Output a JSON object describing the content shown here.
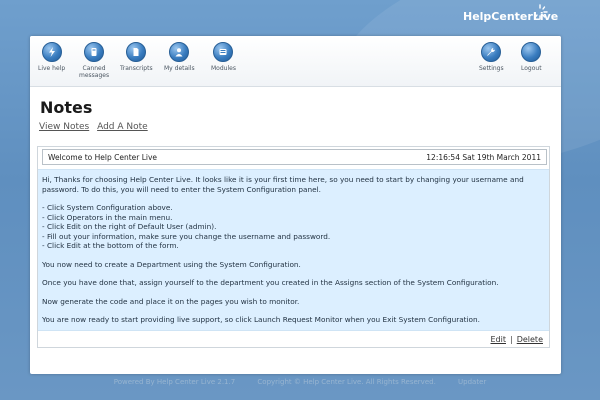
{
  "brand": {
    "name": "HelpCenterLive"
  },
  "toolbar": {
    "left_items": [
      {
        "label": "Live help",
        "icon": "lightning-icon"
      },
      {
        "label": "Canned\nmessages",
        "icon": "canned-messages-icon"
      },
      {
        "label": "Transcripts",
        "icon": "document-icon"
      },
      {
        "label": "My details",
        "icon": "user-icon"
      },
      {
        "label": "Modules",
        "icon": "modules-icon"
      }
    ],
    "right_items": [
      {
        "label": "Settings",
        "icon": "wrench-icon"
      },
      {
        "label": "Logout",
        "icon": "logout-icon"
      }
    ]
  },
  "page": {
    "title": "Notes",
    "links": [
      "View Notes",
      "Add A Note"
    ]
  },
  "note": {
    "title": "Welcome to Help Center Live",
    "timestamp": "12:16:54 Sat 19th March 2011",
    "intro": "Hi, Thanks for choosing Help Center Live. It looks like it is your first time here, so you need to start by changing your username and password. To do this, you will need to enter the System Configuration panel.",
    "steps": [
      "- Click System Configuration above.",
      "- Click Operators in the main menu.",
      "- Click Edit on the right of Default User (admin).",
      "- Fill out your information, make sure you change the username and password.",
      "- Click Edit at the bottom of the form."
    ],
    "para1": "You now need to create a Department using the System Configuration.",
    "para2": "Once you have done that, assign yourself to the department you created in the Assigns section of the System Configuration.",
    "para3": "Now generate the code and place it on the pages you wish to monitor.",
    "para4": "You are now ready to start providing live support, so click Launch Request Monitor when you Exit System Configuration.",
    "edit_label": "Edit",
    "delete_label": "Delete",
    "separator": "|"
  },
  "footer": {
    "powered": "Powered By Help Center Live 2.1.7",
    "copyright": "Copyright © Help Center Live. All Rights Reserved.",
    "updater": "Updater"
  },
  "colors": {
    "background": "#5f8fbf",
    "note_body": "#dcefff",
    "icon_blue": "#3a7dc0"
  }
}
